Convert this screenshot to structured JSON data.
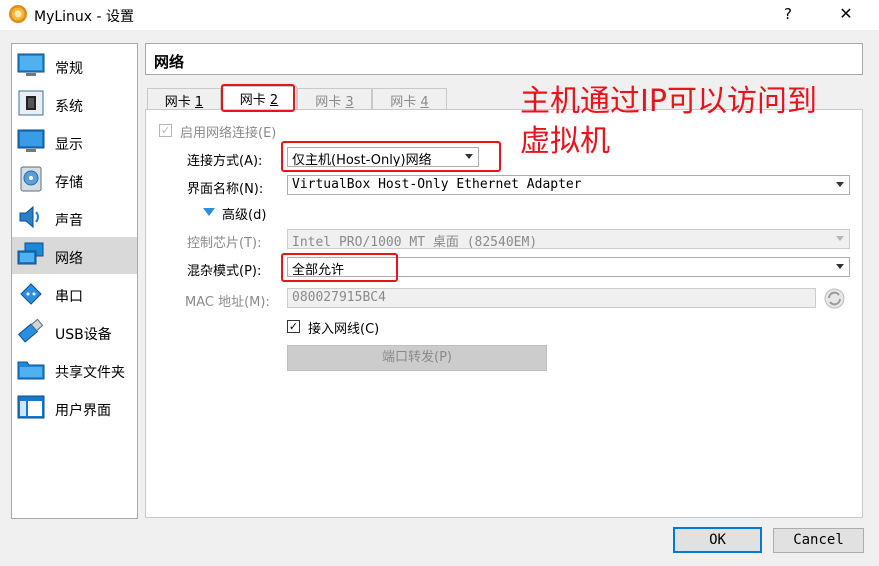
{
  "window": {
    "title": "MyLinux - 设置",
    "help": "?",
    "close": "✕"
  },
  "sidebar": {
    "items": [
      {
        "label": "常规",
        "icon": "general-icon"
      },
      {
        "label": "系统",
        "icon": "system-icon"
      },
      {
        "label": "显示",
        "icon": "display-icon"
      },
      {
        "label": "存储",
        "icon": "storage-icon"
      },
      {
        "label": "声音",
        "icon": "audio-icon"
      },
      {
        "label": "网络",
        "icon": "network-icon",
        "selected": true
      },
      {
        "label": "串口",
        "icon": "serial-port-icon"
      },
      {
        "label": "USB设备",
        "icon": "usb-icon"
      },
      {
        "label": "共享文件夹",
        "icon": "shared-folder-icon"
      },
      {
        "label": "用户界面",
        "icon": "user-interface-icon"
      }
    ]
  },
  "panel": {
    "title": "网络",
    "tabs": [
      {
        "label": "网卡 ",
        "num": "1"
      },
      {
        "label": "网卡 ",
        "num": "2"
      },
      {
        "label": "网卡 ",
        "num": "3"
      },
      {
        "label": "网卡 ",
        "num": "4"
      }
    ],
    "enable_adapter": "启用网络连接(E)",
    "attached_label": "连接方式(A):",
    "attached_value": "仅主机(Host-Only)网络",
    "name_label": "界面名称(N):",
    "name_value": "VirtualBox Host-Only Ethernet Adapter",
    "advanced_label": "高级(d)",
    "adapter_type_label": "控制芯片(T):",
    "adapter_type_value": "Intel PRO/1000 MT 桌面 (82540EM)",
    "promiscuous_label": "混杂模式(P):",
    "promiscuous_value": "全部允许",
    "mac_label": "MAC 地址(M):",
    "mac_value": "080027915BC4",
    "cable_label": "接入网线(C)",
    "port_forward_label": "端口转发(P)"
  },
  "buttons": {
    "ok": "OK",
    "cancel": "Cancel"
  },
  "annotation": {
    "line1": "主机通过IP可以访问到",
    "line2": "虚拟机",
    "color": "#e8141c"
  }
}
